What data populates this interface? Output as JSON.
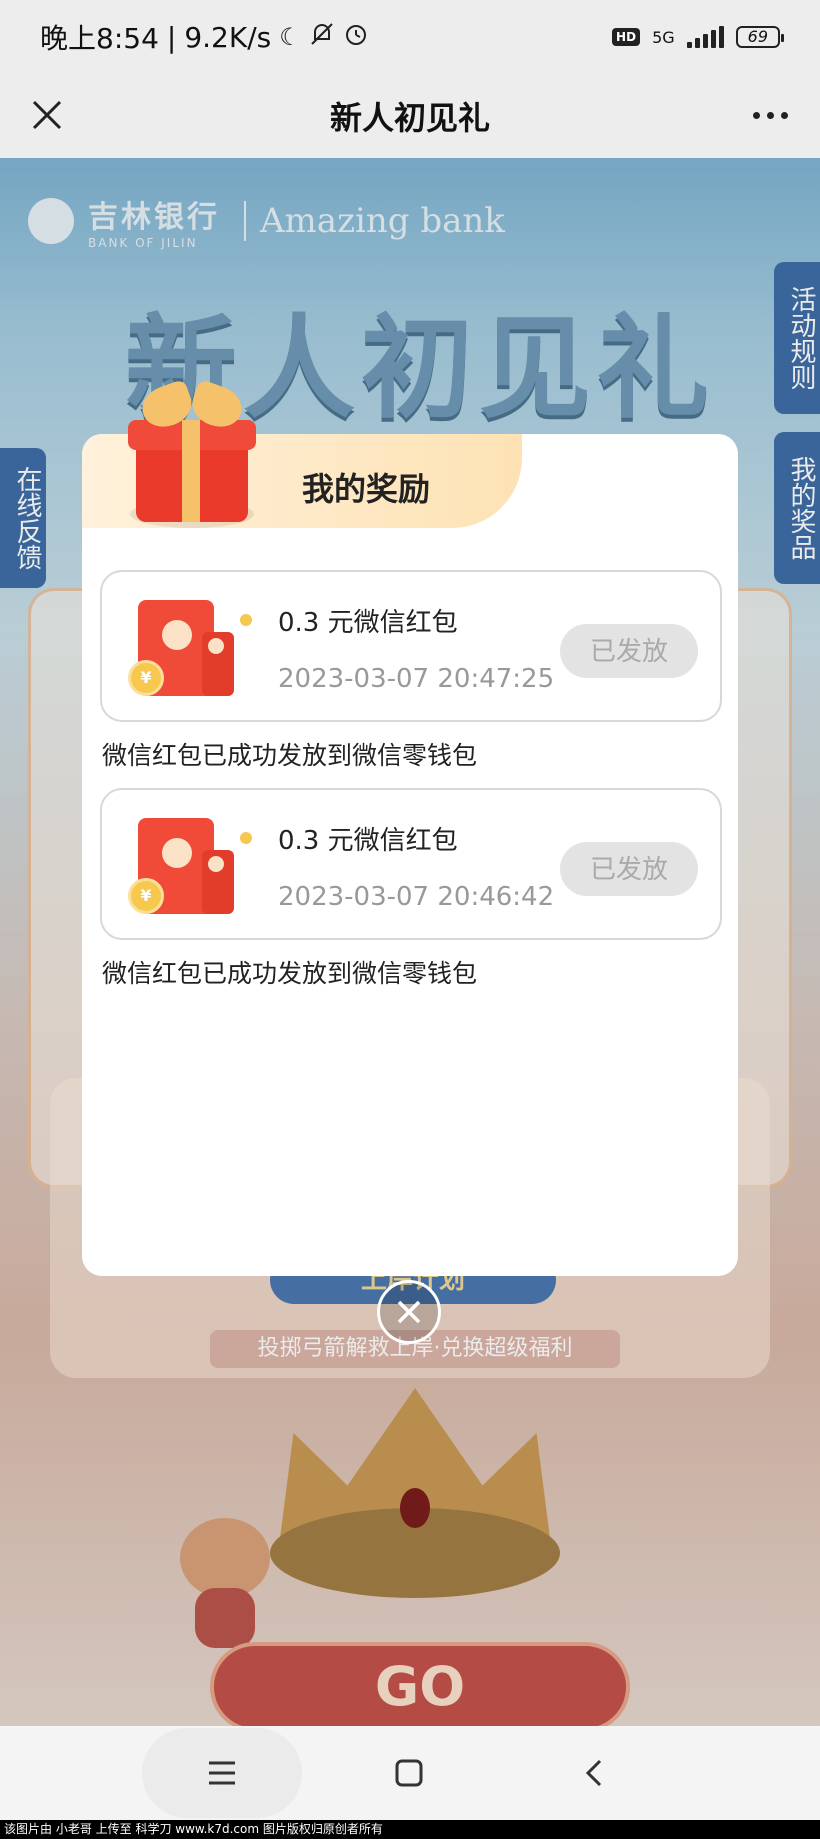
{
  "status_bar": {
    "time": "晚上8:54",
    "separator": "|",
    "speed": "9.2K/s",
    "network": "5G",
    "hd": "HD",
    "battery": "69"
  },
  "nav": {
    "title": "新人初见礼"
  },
  "background": {
    "bank_name": "吉林银行",
    "bank_en": "BANK OF JILIN",
    "slogan": "Amazing bank",
    "title": "新人初见礼",
    "tab_rules": "活动规则",
    "tab_prizes": "我的奖品",
    "tab_feedback": "在线反馈",
    "plan_label": "上岸计划",
    "subtitle": "投掷弓箭解救上岸·兑换超级福利",
    "go_label": "GO"
  },
  "modal": {
    "title": "我的奖励",
    "rewards": [
      {
        "name": "0.3 元微信红包",
        "time": "2023-03-07 20:47:25",
        "status": "已发放",
        "note": "微信红包已成功发放到微信零钱包"
      },
      {
        "name": "0.3 元微信红包",
        "time": "2023-03-07 20:46:42",
        "status": "已发放",
        "note": "微信红包已成功发放到微信零钱包"
      }
    ],
    "coin_symbol": "¥"
  },
  "footer": {
    "text": "该图片由 小老哥 上传至 科学刀 www.k7d.com 图片版权归原创者所有"
  },
  "colors": {
    "accent_red": "#ef4b38",
    "header_gold": "#fde2b4",
    "disabled_gray": "#e3e3e3"
  }
}
